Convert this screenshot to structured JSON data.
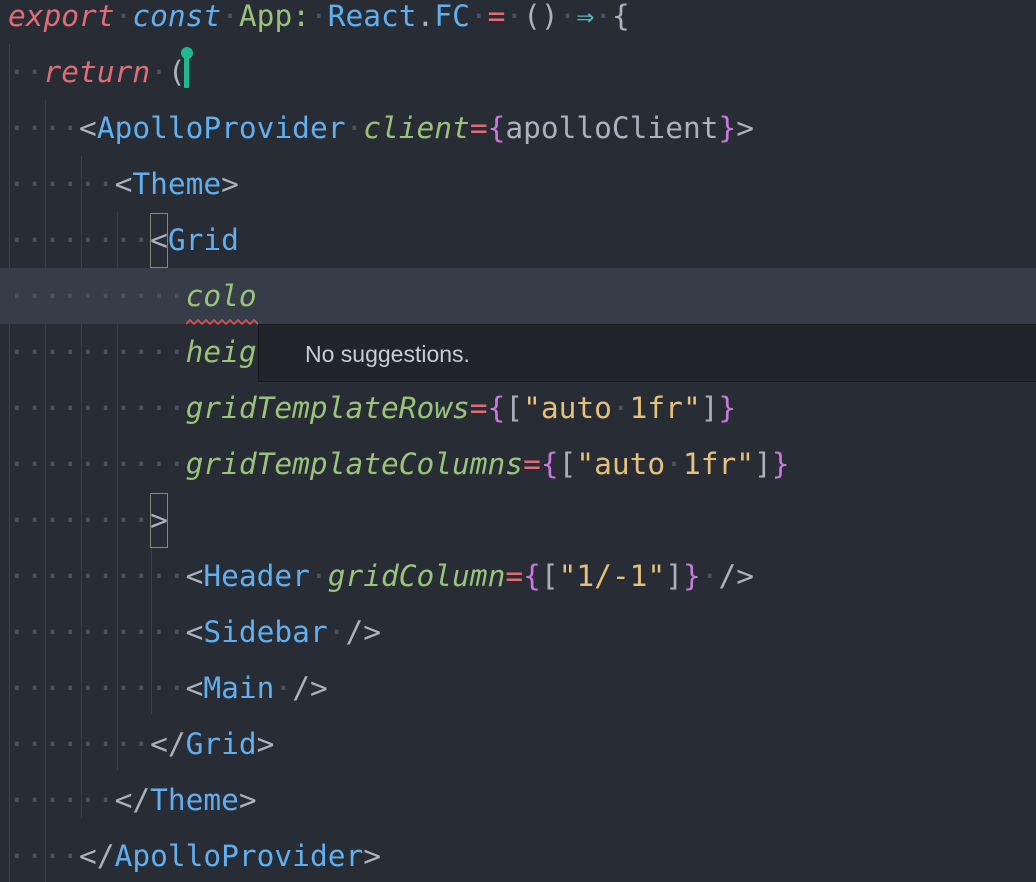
{
  "editor": {
    "language": "tsx",
    "lines": [
      {
        "segments": [
          {
            "t": "export",
            "c": "kw"
          },
          {
            "t": "·",
            "c": "ws"
          },
          {
            "t": "const",
            "c": "kwc"
          },
          {
            "t": "·",
            "c": "ws"
          },
          {
            "t": "App:",
            "c": "ty"
          },
          {
            "t": "·",
            "c": "ws"
          },
          {
            "t": "React",
            "c": "id"
          },
          {
            "t": ".",
            "c": "pn"
          },
          {
            "t": "FC",
            "c": "id"
          },
          {
            "t": "·",
            "c": "ws"
          },
          {
            "t": "=",
            "c": "op"
          },
          {
            "t": "·",
            "c": "ws"
          },
          {
            "t": "()",
            "c": "pn"
          },
          {
            "t": "·",
            "c": "ws"
          },
          {
            "t": "⇒",
            "c": "arrow"
          },
          {
            "t": "·",
            "c": "ws"
          },
          {
            "t": "{",
            "c": "pn"
          }
        ]
      },
      {
        "segments": [
          {
            "t": "··",
            "c": "ws"
          },
          {
            "t": "return",
            "c": "kw"
          },
          {
            "t": "·",
            "c": "ws"
          },
          {
            "t": "(",
            "c": "pn"
          }
        ]
      },
      {
        "segments": [
          {
            "t": "····",
            "c": "ws"
          },
          {
            "t": "<",
            "c": "pn"
          },
          {
            "t": "ApolloProvider",
            "c": "id"
          },
          {
            "t": "·",
            "c": "ws"
          },
          {
            "t": "client",
            "c": "attr"
          },
          {
            "t": "=",
            "c": "op"
          },
          {
            "t": "{",
            "c": "br"
          },
          {
            "t": "apolloClient",
            "c": "var"
          },
          {
            "t": "}",
            "c": "br"
          },
          {
            "t": ">",
            "c": "pn"
          }
        ]
      },
      {
        "segments": [
          {
            "t": "······",
            "c": "ws"
          },
          {
            "t": "<",
            "c": "pn"
          },
          {
            "t": "Theme",
            "c": "id"
          },
          {
            "t": ">",
            "c": "pn"
          }
        ]
      },
      {
        "segments": [
          {
            "t": "········",
            "c": "ws"
          },
          {
            "t": "<",
            "c": "pn"
          },
          {
            "t": "Grid",
            "c": "id"
          }
        ]
      },
      {
        "segments": [
          {
            "t": "··········",
            "c": "ws"
          },
          {
            "t": "colo",
            "c": "attr"
          }
        ]
      },
      {
        "segments": [
          {
            "t": "··········",
            "c": "ws"
          },
          {
            "t": "heig",
            "c": "attr"
          }
        ]
      },
      {
        "segments": [
          {
            "t": "··········",
            "c": "ws"
          },
          {
            "t": "gridTemplateRows",
            "c": "attr"
          },
          {
            "t": "=",
            "c": "op"
          },
          {
            "t": "{",
            "c": "br"
          },
          {
            "t": "[",
            "c": "pn"
          },
          {
            "t": "\"auto",
            "c": "str"
          },
          {
            "t": "·",
            "c": "ws"
          },
          {
            "t": "1fr\"",
            "c": "str"
          },
          {
            "t": "]",
            "c": "pn"
          },
          {
            "t": "}",
            "c": "br"
          }
        ]
      },
      {
        "segments": [
          {
            "t": "··········",
            "c": "ws"
          },
          {
            "t": "gridTemplateColumns",
            "c": "attr"
          },
          {
            "t": "=",
            "c": "op"
          },
          {
            "t": "{",
            "c": "br"
          },
          {
            "t": "[",
            "c": "pn"
          },
          {
            "t": "\"auto",
            "c": "str"
          },
          {
            "t": "·",
            "c": "ws"
          },
          {
            "t": "1fr\"",
            "c": "str"
          },
          {
            "t": "]",
            "c": "pn"
          },
          {
            "t": "}",
            "c": "br"
          }
        ]
      },
      {
        "segments": [
          {
            "t": "········",
            "c": "ws"
          },
          {
            "t": ">",
            "c": "pn"
          }
        ]
      },
      {
        "segments": [
          {
            "t": "··········",
            "c": "ws"
          },
          {
            "t": "<",
            "c": "pn"
          },
          {
            "t": "Header",
            "c": "id"
          },
          {
            "t": "·",
            "c": "ws"
          },
          {
            "t": "gridColumn",
            "c": "attr"
          },
          {
            "t": "=",
            "c": "op"
          },
          {
            "t": "{",
            "c": "br"
          },
          {
            "t": "[",
            "c": "pn"
          },
          {
            "t": "\"1/-1\"",
            "c": "str"
          },
          {
            "t": "]",
            "c": "pn"
          },
          {
            "t": "}",
            "c": "br"
          },
          {
            "t": "·",
            "c": "ws"
          },
          {
            "t": "/>",
            "c": "pn"
          }
        ]
      },
      {
        "segments": [
          {
            "t": "··········",
            "c": "ws"
          },
          {
            "t": "<",
            "c": "pn"
          },
          {
            "t": "Sidebar",
            "c": "id"
          },
          {
            "t": "·",
            "c": "ws"
          },
          {
            "t": "/>",
            "c": "pn"
          }
        ]
      },
      {
        "segments": [
          {
            "t": "··········",
            "c": "ws"
          },
          {
            "t": "<",
            "c": "pn"
          },
          {
            "t": "Main",
            "c": "id"
          },
          {
            "t": "·",
            "c": "ws"
          },
          {
            "t": "/>",
            "c": "pn"
          }
        ]
      },
      {
        "segments": [
          {
            "t": "········",
            "c": "ws"
          },
          {
            "t": "</",
            "c": "pn"
          },
          {
            "t": "Grid",
            "c": "id"
          },
          {
            "t": ">",
            "c": "pn"
          }
        ]
      },
      {
        "segments": [
          {
            "t": "······",
            "c": "ws"
          },
          {
            "t": "</",
            "c": "pn"
          },
          {
            "t": "Theme",
            "c": "id"
          },
          {
            "t": ">",
            "c": "pn"
          }
        ]
      },
      {
        "segments": [
          {
            "t": "····",
            "c": "ws"
          },
          {
            "t": "</",
            "c": "pn"
          },
          {
            "t": "ApolloProvider",
            "c": "id"
          },
          {
            "t": ">",
            "c": "pn"
          }
        ]
      }
    ]
  },
  "tooltip": {
    "message": "No suggestions."
  },
  "colors": {
    "background": "#282c34",
    "current_line": "#373d48",
    "cursor": "#1db992",
    "error_squiggle": "#e05252"
  }
}
